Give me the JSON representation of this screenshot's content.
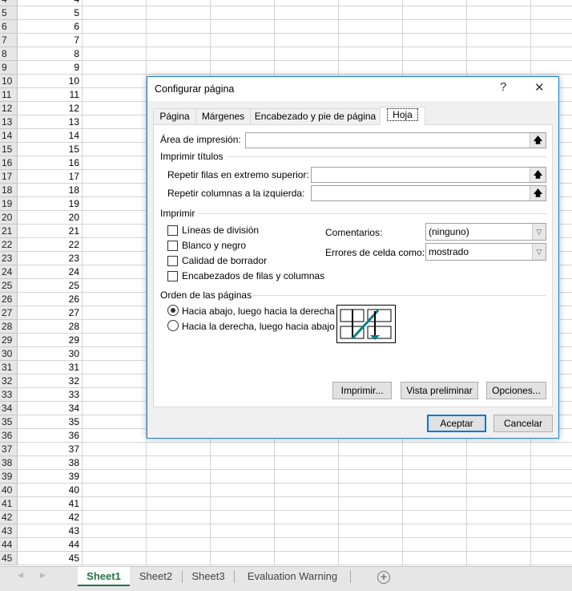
{
  "sheet": {
    "rows": [
      4,
      5,
      6,
      7,
      8,
      9,
      10,
      11,
      12,
      13,
      14,
      15,
      16,
      17,
      18,
      19,
      20,
      21,
      22,
      23,
      24,
      25,
      26,
      27,
      28,
      29,
      30,
      31,
      32,
      33,
      34,
      35,
      36,
      37,
      38,
      39,
      40,
      41,
      42,
      43,
      44,
      45
    ],
    "col_a_values": [
      4,
      5,
      6,
      7,
      8,
      9,
      10,
      11,
      12,
      13,
      14,
      15,
      16,
      17,
      18,
      19,
      20,
      21,
      22,
      23,
      24,
      25,
      26,
      27,
      28,
      29,
      30,
      31,
      32,
      33,
      34,
      35,
      36,
      37,
      38,
      39,
      40,
      41,
      42,
      43,
      44,
      45
    ]
  },
  "sheet_tabs": {
    "items": [
      "Sheet1",
      "Sheet2",
      "Sheet3",
      "Evaluation Warning"
    ],
    "active": "Sheet1",
    "add_icon": "plus-circle-icon",
    "accent": "#217346"
  },
  "dialog": {
    "title": "Configurar página",
    "help": "?",
    "close": "✕",
    "tabs": [
      "Página",
      "Márgenes",
      "Encabezado y pie de página",
      "Hoja"
    ],
    "active_tab": "Hoja",
    "print_area_label": "Área de impresión:",
    "print_area_value": "",
    "print_titles_group": "Imprimir títulos",
    "repeat_rows_label": "Repetir filas en extremo superior:",
    "repeat_rows_value": "",
    "repeat_cols_label": "Repetir columnas a la izquierda:",
    "repeat_cols_value": "",
    "print_group": "Imprimir",
    "checkboxes": [
      {
        "label": "Líneas de división",
        "checked": false
      },
      {
        "label": "Blanco y negro",
        "checked": false
      },
      {
        "label": "Calidad de borrador",
        "checked": false
      },
      {
        "label": "Encabezados de filas y columnas",
        "checked": false
      }
    ],
    "comments_label": "Comentarios:",
    "comments_value": "(ninguno)",
    "errors_label": "Errores de celda como:",
    "errors_value": "mostrado",
    "order_group": "Orden de las páginas",
    "radios": [
      {
        "label": "Hacia abajo, luego hacia la derecha",
        "selected": true
      },
      {
        "label": "Hacia la derecha, luego hacia abajo",
        "selected": false
      }
    ],
    "buttons": {
      "print": "Imprimir...",
      "preview": "Vista preliminar",
      "options": "Opciones...",
      "ok": "Aceptar",
      "cancel": "Cancelar"
    },
    "accent": "#0078d7"
  }
}
